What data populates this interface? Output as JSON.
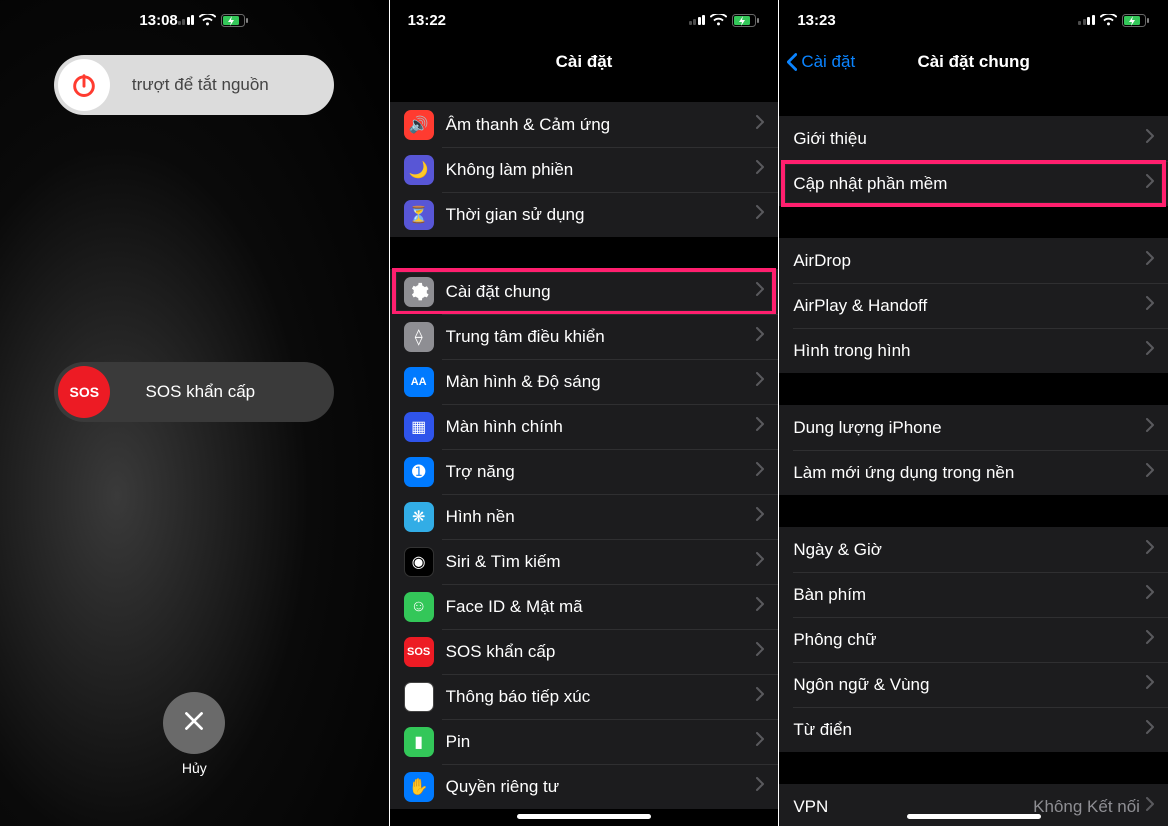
{
  "screen1": {
    "time": "13:08",
    "power_label": "trượt để tắt nguồn",
    "sos_label": "SOS khẩn cấp",
    "sos_knob": "SOS",
    "cancel": "Hủy"
  },
  "screen2": {
    "time": "13:22",
    "title": "Cài đặt",
    "groups": [
      [
        {
          "label": "Âm thanh & Cảm ứng",
          "icon": "sound",
          "bg": "ic-red"
        },
        {
          "label": "Không làm phiền",
          "icon": "moon",
          "bg": "ic-purple"
        },
        {
          "label": "Thời gian sử dụng",
          "icon": "hourglass",
          "bg": "ic-hg"
        }
      ],
      [
        {
          "label": "Cài đặt chung",
          "icon": "gear",
          "bg": "ic-gray",
          "highlight": true
        },
        {
          "label": "Trung tâm điều khiển",
          "icon": "switches",
          "bg": "ic-gray"
        },
        {
          "label": "Màn hình & Độ sáng",
          "icon": "AA",
          "bg": "ic-blue",
          "textIcon": true
        },
        {
          "label": "Màn hình chính",
          "icon": "grid",
          "bg": "ic-darkblue"
        },
        {
          "label": "Trợ năng",
          "icon": "accessibility",
          "bg": "ic-blue"
        },
        {
          "label": "Hình nền",
          "icon": "flower",
          "bg": "ic-cyan"
        },
        {
          "label": "Siri & Tìm kiếm",
          "icon": "siri",
          "bg": "ic-black"
        },
        {
          "label": "Face ID & Mật mã",
          "icon": "faceid",
          "bg": "ic-green"
        },
        {
          "label": "SOS khẩn cấp",
          "icon": "SOS",
          "bg": "ic-sos",
          "textIcon": true
        },
        {
          "label": "Thông báo tiếp xúc",
          "icon": "exposure",
          "bg": "ic-exposure"
        },
        {
          "label": "Pin",
          "icon": "battery",
          "bg": "ic-pin"
        },
        {
          "label": "Quyền riêng tư",
          "icon": "hand",
          "bg": "ic-priv"
        }
      ]
    ]
  },
  "screen3": {
    "time": "13:23",
    "back": "Cài đặt",
    "title": "Cài đặt chung",
    "groups": [
      [
        {
          "label": "Giới thiệu"
        },
        {
          "label": "Cập nhật phần mềm",
          "highlight": true
        }
      ],
      [
        {
          "label": "AirDrop"
        },
        {
          "label": "AirPlay & Handoff"
        },
        {
          "label": "Hình trong hình"
        }
      ],
      [
        {
          "label": "Dung lượng iPhone"
        },
        {
          "label": "Làm mới ứng dụng trong nền"
        }
      ],
      [
        {
          "label": "Ngày & Giờ"
        },
        {
          "label": "Bàn phím"
        },
        {
          "label": "Phông chữ"
        },
        {
          "label": "Ngôn ngữ & Vùng"
        },
        {
          "label": "Từ điển"
        }
      ],
      [
        {
          "label": "VPN",
          "value": "Không Kết nối"
        }
      ]
    ]
  }
}
